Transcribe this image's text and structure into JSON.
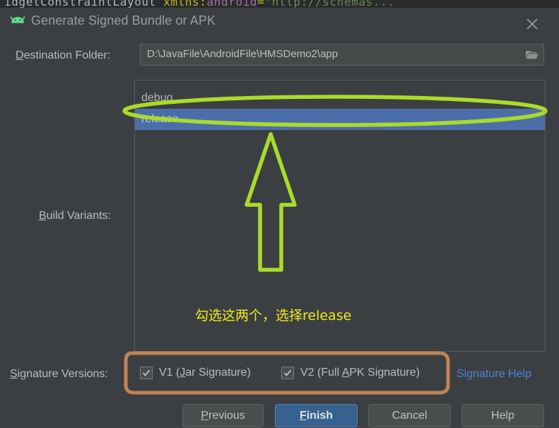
{
  "background_code": {
    "tag": "idgetConstraintLayout",
    "attr": " xmlns:",
    "ns": "android",
    "eq": "=",
    "value": "\"http://schemas...",
    "full_line": "idgetConstraintLayout xmlns:android=\"http://schemas..."
  },
  "dialog": {
    "title": "Generate Signed Bundle or APK",
    "icon": "android-robot-icon",
    "close_icon": "close-icon"
  },
  "destination": {
    "label_pre": "D",
    "label_post": "estination Folder:",
    "value": "D:\\JavaFile\\AndroidFile\\HMSDemo2\\app",
    "browse_icon": "folder-icon"
  },
  "build_variants": {
    "label_pre": "B",
    "label_post": "uild Variants:",
    "items": [
      {
        "label": "debug",
        "selected": false
      },
      {
        "label": "release",
        "selected": true
      }
    ],
    "selected_value": "release",
    "selection_color": "#4b6eab"
  },
  "signature": {
    "label_pre": "S",
    "label_post": "ignature Versions:",
    "checkboxes": [
      {
        "pre": "V1 (",
        "mn": "J",
        "post": "ar Signature)",
        "checked": true
      },
      {
        "pre": "V2 (Full ",
        "mn": "A",
        "post": "PK Signature)",
        "checked": true
      }
    ],
    "help_link": "Signature Help",
    "help_link_color": "#4d84d8"
  },
  "buttons": [
    {
      "mn": "P",
      "post": "revious",
      "name": "previous-button",
      "default": false
    },
    {
      "mn": "F",
      "post": "inish",
      "name": "finish-button",
      "default": true
    },
    {
      "mn": "",
      "post": "Cancel",
      "name": "cancel-button",
      "default": false
    },
    {
      "mn": "",
      "post": "Help",
      "name": "help-button",
      "default": false
    }
  ],
  "annotations": {
    "note_text": "勾选这两个，选择release",
    "note_color": "#f2e821",
    "highlight_color": "#aadb2a",
    "checkbox_highlight_color": "#c08457"
  }
}
